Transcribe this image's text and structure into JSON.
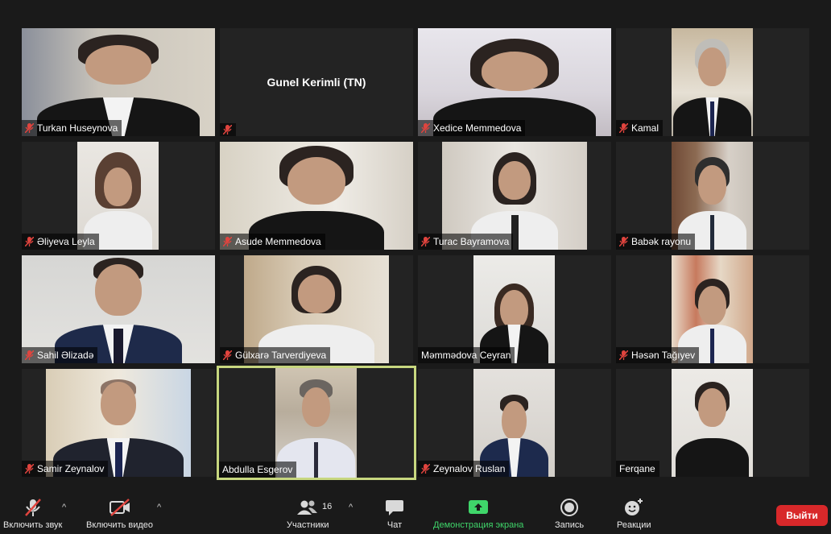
{
  "participants": [
    {
      "name": "Turkan Huseynova",
      "muted": true,
      "video": true
    },
    {
      "name": "",
      "display_name": "Gunel Kerimli (TN)",
      "muted": true,
      "video": false
    },
    {
      "name": "Xedice Memmedova",
      "muted": true,
      "video": true
    },
    {
      "name": "Kamal",
      "muted": true,
      "video": true
    },
    {
      "name": "Əliyeva Leyla",
      "muted": true,
      "video": true
    },
    {
      "name": "Asude Memmedova",
      "muted": true,
      "video": true
    },
    {
      "name": "Turac Bayramova",
      "muted": true,
      "video": true
    },
    {
      "name": "Babək rayonu",
      "muted": true,
      "video": true
    },
    {
      "name": "Sahil Əlizadə",
      "muted": true,
      "video": true
    },
    {
      "name": "Gülxarə Tarverdiyeva",
      "muted": true,
      "video": true
    },
    {
      "name": "Məmmədova Ceyran",
      "muted": false,
      "video": true
    },
    {
      "name": "Həsən Tağıyev",
      "muted": true,
      "video": true
    },
    {
      "name": "Samir Zeynalov",
      "muted": true,
      "video": true
    },
    {
      "name": "Abdulla Esgerov",
      "muted": false,
      "video": true,
      "active_speaker": true
    },
    {
      "name": "Zeynalov Ruslan",
      "muted": true,
      "video": true
    },
    {
      "name": "Ferqane",
      "muted": false,
      "video": true
    }
  ],
  "toolbar": {
    "unmute_label": "Включить звук",
    "start_video_label": "Включить видео",
    "participants_label": "Участники",
    "participants_count": "16",
    "chat_label": "Чат",
    "share_label": "Демонстрация экрана",
    "record_label": "Запись",
    "reactions_label": "Реакции",
    "leave_label": "Выйти",
    "caret": "^"
  },
  "colors": {
    "background": "#1a1a1a",
    "tile": "#232323",
    "active_border": "#c7d77f",
    "muted_red": "#e0443e",
    "share_green": "#3fd66a",
    "leave_red": "#d8282a"
  },
  "icons": [
    "mic-muted-icon",
    "video-off-icon",
    "participants-icon",
    "chat-icon",
    "share-screen-icon",
    "record-icon",
    "reactions-icon"
  ]
}
